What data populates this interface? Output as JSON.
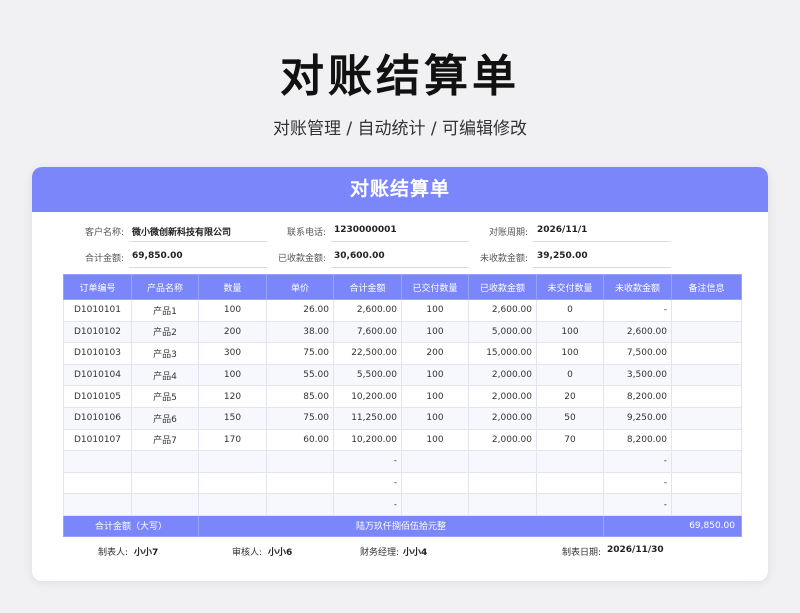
{
  "title": "对账结算单",
  "subtitle": "对账管理 /  自动统计  /  可编辑修改",
  "card": {
    "header": "对账结算单",
    "info": {
      "customer_label": "客户名称:",
      "customer_value": "微小微创新科技有限公司",
      "phone_label": "联系电话:",
      "phone_value": "1230000001",
      "period_label": "对账周期:",
      "period_value": "2026/11/1",
      "total_label": "合计金额:",
      "total_value": "69,850.00",
      "received_label": "已收款金额:",
      "received_value": "30,600.00",
      "unreceived_label": "未收款金额:",
      "unreceived_value": "39,250.00"
    },
    "table": {
      "headers": [
        "订单编号",
        "产品名称",
        "数量",
        "单价",
        "合计金额",
        "已交付数量",
        "已收款金额",
        "未交付数量",
        "未收款金额",
        "备注信息"
      ],
      "rows": [
        [
          "D1010101",
          "产品1",
          "100",
          "26.00",
          "2,600.00",
          "100",
          "2,600.00",
          "0",
          "-",
          ""
        ],
        [
          "D1010102",
          "产品2",
          "200",
          "38.00",
          "7,600.00",
          "100",
          "5,000.00",
          "100",
          "2,600.00",
          ""
        ],
        [
          "D1010103",
          "产品3",
          "300",
          "75.00",
          "22,500.00",
          "200",
          "15,000.00",
          "100",
          "7,500.00",
          ""
        ],
        [
          "D1010104",
          "产品4",
          "100",
          "55.00",
          "5,500.00",
          "100",
          "2,000.00",
          "0",
          "3,500.00",
          ""
        ],
        [
          "D1010105",
          "产品5",
          "120",
          "85.00",
          "10,200.00",
          "100",
          "2,000.00",
          "20",
          "8,200.00",
          ""
        ],
        [
          "D1010106",
          "产品6",
          "150",
          "75.00",
          "11,250.00",
          "100",
          "2,000.00",
          "50",
          "9,250.00",
          ""
        ],
        [
          "D1010107",
          "产品7",
          "170",
          "60.00",
          "10,200.00",
          "100",
          "2,000.00",
          "70",
          "8,200.00",
          ""
        ],
        [
          "",
          "",
          "",
          "",
          "-",
          "",
          "",
          "",
          "-",
          ""
        ],
        [
          "",
          "",
          "",
          "",
          "-",
          "",
          "",
          "",
          "-",
          ""
        ],
        [
          "",
          "",
          "",
          "",
          "-",
          "",
          "",
          "",
          "-",
          ""
        ]
      ],
      "total_label": "合计金额（大写）",
      "total_words": "陆万玖仟捌佰伍拾元整",
      "total_amount": "69,850.00"
    },
    "footer": {
      "preparer_label": "制表人:",
      "preparer_value": "小小7",
      "reviewer_label": "审核人:",
      "reviewer_value": "小小6",
      "manager_label": "财务经理:",
      "manager_value": "小小4",
      "date_label": "制表日期:",
      "date_value": "2026/11/30"
    }
  }
}
